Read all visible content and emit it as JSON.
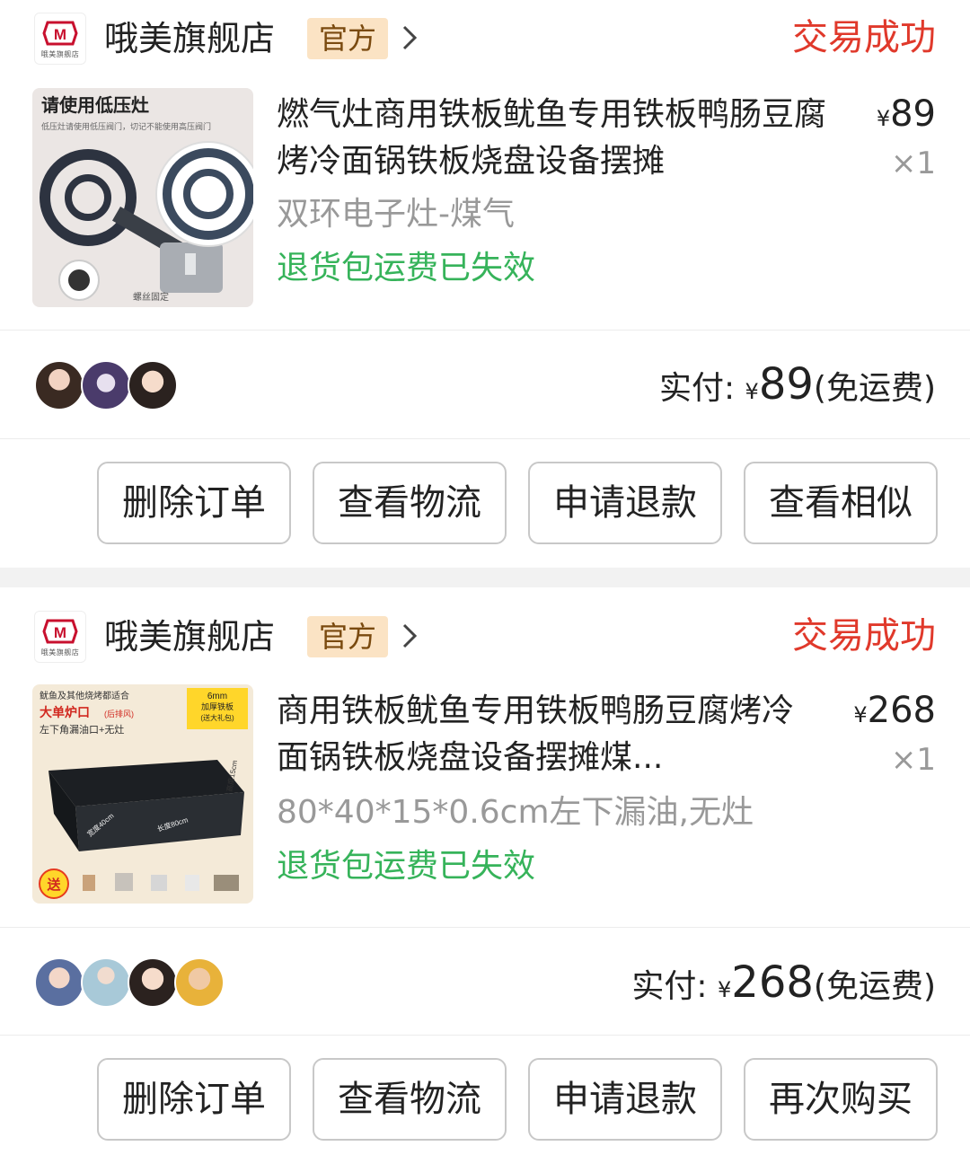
{
  "orders": [
    {
      "shop": {
        "name": "哦美旗舰店",
        "badge": "官方",
        "logo_caption": "哦美旗舰店"
      },
      "status": "交易成功",
      "product": {
        "title": "燃气灶商用铁板鱿鱼专用铁板鸭肠豆腐烤冷面锅铁板烧盘设备摆摊",
        "spec": "双环电子灶-煤气",
        "refund_note": "退货包运费已失效",
        "price_symbol": "¥",
        "price": "89",
        "quantity": "×1",
        "image": {
          "headline": "请使用低压灶",
          "subtitle": "低压灶请使用低压阀门，切记不能使用高压阀门",
          "caption": "螺丝固定"
        }
      },
      "payment": {
        "label": "实付:",
        "symbol": "¥",
        "amount": "89",
        "note": "(免运费)"
      },
      "avatars": [
        "avatar-woman-1",
        "avatar-woman-2",
        "avatar-woman-3"
      ],
      "actions": [
        "删除订单",
        "查看物流",
        "申请退款",
        "查看相似"
      ]
    },
    {
      "shop": {
        "name": "哦美旗舰店",
        "badge": "官方",
        "logo_caption": "哦美旗舰店"
      },
      "status": "交易成功",
      "product": {
        "title": "商用铁板鱿鱼专用铁板鸭肠豆腐烤冷面锅铁板烧盘设备摆摊煤...",
        "spec": "80*40*15*0.6cm左下漏油,无灶",
        "refund_note": "退货包运费已失效",
        "price_symbol": "¥",
        "price": "268",
        "quantity": "×1",
        "image": {
          "line1": "鱿鱼及其他烧烤都适合",
          "line2": "大单炉口",
          "line2b": "(后排风)",
          "line3": "左下角漏油口+无灶",
          "tag1": "6mm",
          "tag2": "加厚铁板",
          "tag3": "(送大礼包)",
          "gift": "送",
          "dim_w": "宽度40cm",
          "dim_l": "长度80cm",
          "dim_h": "高度15cm"
        }
      },
      "payment": {
        "label": "实付:",
        "symbol": "¥",
        "amount": "268",
        "note": "(免运费)"
      },
      "avatars": [
        "avatar-woman-1",
        "avatar-woman-2",
        "avatar-woman-3",
        "avatar-child"
      ],
      "actions": [
        "删除订单",
        "查看物流",
        "申请退款",
        "再次购买"
      ]
    }
  ],
  "colors": {
    "status": "#e0392b",
    "refund": "#36b35a",
    "badge_bg": "#fbe3c4",
    "badge_fg": "#7a4a0f",
    "separator": "#f2f2f2"
  }
}
